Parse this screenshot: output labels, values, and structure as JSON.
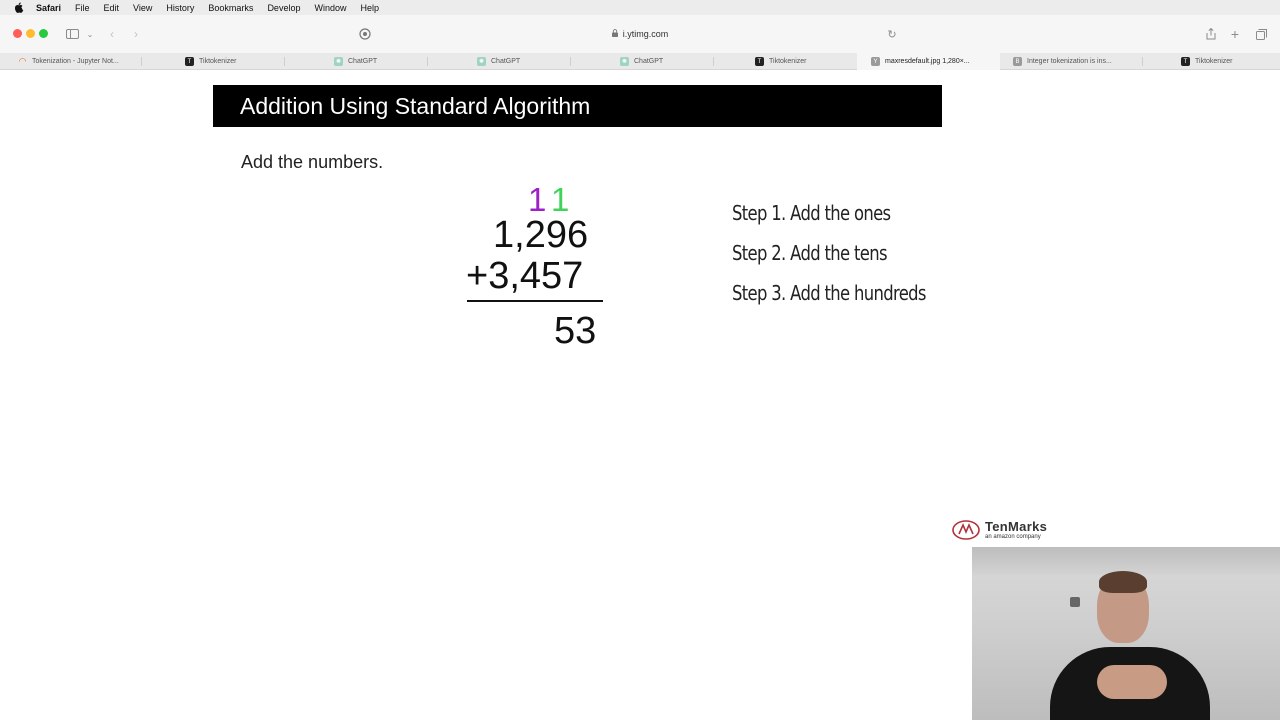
{
  "menubar": {
    "app": "Safari",
    "items": [
      "File",
      "Edit",
      "View",
      "History",
      "Bookmarks",
      "Develop",
      "Window",
      "Help"
    ]
  },
  "toolbar": {
    "url": "i.ytimg.com"
  },
  "tabs": [
    {
      "label": "Tokenization - Jupyter Not...",
      "icon": "jupyter-icon",
      "active": false
    },
    {
      "label": "Tiktokenizer",
      "icon": "tiktokenizer-icon",
      "active": false
    },
    {
      "label": "ChatGPT",
      "icon": "chatgpt-icon",
      "active": false
    },
    {
      "label": "ChatGPT",
      "icon": "chatgpt-icon",
      "active": false
    },
    {
      "label": "ChatGPT",
      "icon": "chatgpt-icon",
      "active": false
    },
    {
      "label": "Tiktokenizer",
      "icon": "tiktokenizer-icon",
      "active": false
    },
    {
      "label": "maxresdefault.jpg 1,280×...",
      "icon": "image-icon",
      "active": true
    },
    {
      "label": "Integer tokenization is ins...",
      "icon": "page-icon",
      "active": false
    },
    {
      "label": "Tiktokenizer",
      "icon": "tiktokenizer-icon",
      "active": false
    }
  ],
  "slide": {
    "title": "Addition Using Standard Algorithm",
    "instruction": "Add the numbers.",
    "carry_digits": [
      "1",
      "1"
    ],
    "addend_1": "1,296",
    "addend_2": "+3,457",
    "partial_sum": "53",
    "steps": [
      "Step 1. Add the ones",
      "Step 2. Add the tens",
      "Step 3. Add the hundreds"
    ],
    "logo_name": "TenMarks",
    "logo_tagline": "an amazon company"
  },
  "colors": {
    "carry_1": "#a020c8",
    "carry_2": "#3fd35a",
    "title_bar": "#000000"
  }
}
